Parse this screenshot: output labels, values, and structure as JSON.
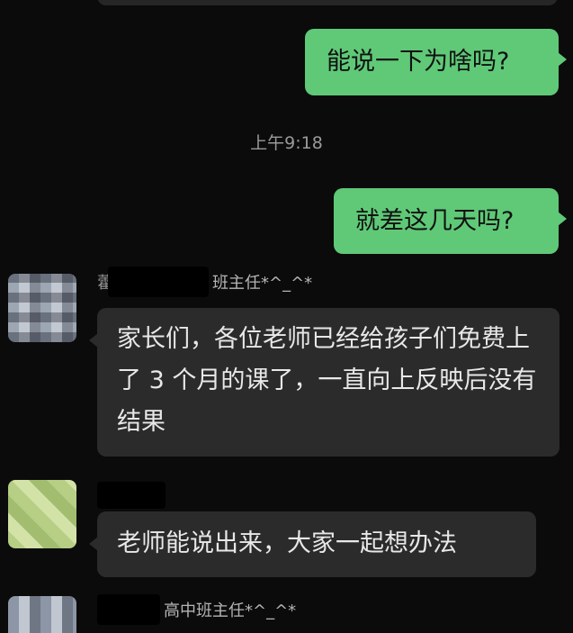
{
  "messages": [
    {
      "direction": "outgoing",
      "text": "能说一下为啥吗?"
    },
    {
      "direction": "outgoing",
      "text": "就差这几天吗?"
    },
    {
      "direction": "incoming",
      "sender": "班主任*^_^*",
      "text": "家长们，各位老师已经给孩子们免费上了 3 个月的课了，一直向上反映后没有结果"
    },
    {
      "direction": "incoming",
      "sender": "",
      "text": "老师能说出来，大家一起想办法"
    },
    {
      "direction": "incoming",
      "sender": "高中班主任*^_^*",
      "text": ""
    }
  ],
  "timestamp": "上午9:18",
  "colors": {
    "background": "#0b0b0b",
    "outgoing_bubble": "#5fc977",
    "incoming_bubble": "#2b2b2b",
    "timestamp_text": "#9a9a9a"
  }
}
